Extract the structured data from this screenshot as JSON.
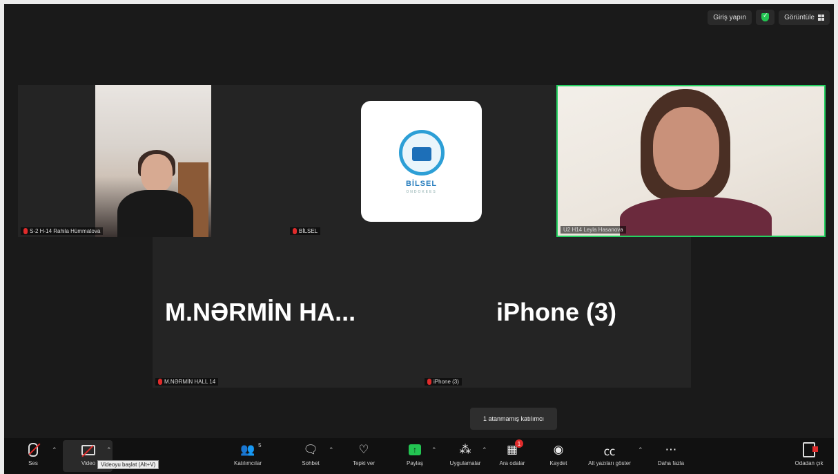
{
  "top_controls": {
    "sign_in": "Giriş yapın",
    "view": "Görüntüle"
  },
  "participants": [
    {
      "name": "S-2 H-14 Rahila Hümmatova",
      "muted": true
    },
    {
      "name": "BİLSEL",
      "muted": true
    },
    {
      "name": "U2 H14 Leyla Hasanova",
      "muted": false,
      "active_speaker": true
    },
    {
      "name": "M.NƏRMİN HALL 14",
      "display": "M.NƏRMİN  HA...",
      "muted": true
    },
    {
      "name": "iPhone (3)",
      "display": "iPhone (3)",
      "muted": true
    }
  ],
  "logo": {
    "title": "BİLSEL",
    "subtitle": "ONDOKEES"
  },
  "unassigned_tooltip": "1 atanmamış katılımcı",
  "toolbar": {
    "audio": "Ses",
    "video": "Video",
    "video_tooltip": "Videoyu başlat (Alt+V)",
    "participants": "Katılımcılar",
    "participants_count": "5",
    "chat": "Sohbet",
    "reactions": "Tepki ver",
    "share": "Paylaş",
    "apps": "Uygulamalar",
    "breakout": "Ara odalar",
    "breakout_badge": "1",
    "record": "Kaydet",
    "captions": "Alt yazıları göster",
    "more": "Daha fazla",
    "leave": "Odadan çık"
  },
  "colors": {
    "active_border": "#23d160",
    "mute_red": "#e02b2b",
    "share_green": "#23c552"
  }
}
